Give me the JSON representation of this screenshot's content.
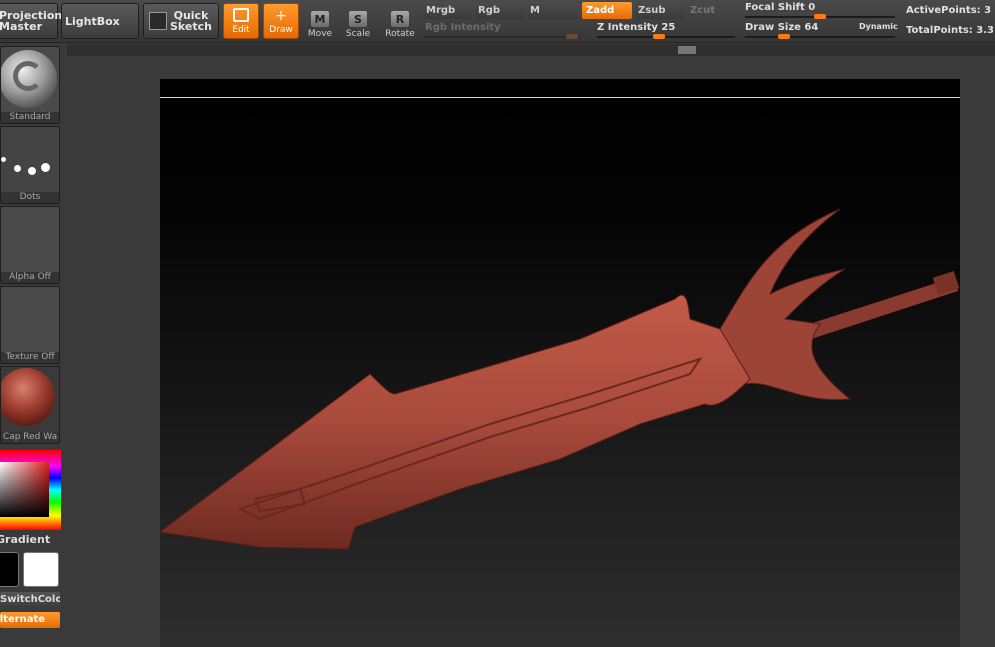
{
  "toolbar": {
    "projection_master": "Projection Master",
    "lightbox": "LightBox",
    "quick_sketch": "Quick Sketch",
    "edit": "Edit",
    "draw": "Draw",
    "move": "Move",
    "scale": "Scale",
    "rotate": "Rotate",
    "move_key": "M",
    "scale_key": "S",
    "rotate_key": "R"
  },
  "modes": {
    "mrgb": "Mrgb",
    "rgb": "Rgb",
    "m": "M",
    "zadd": "Zadd",
    "zsub": "Zsub",
    "zcut": "Zcut",
    "rgb_intensity_label": "Rgb Intensity",
    "z_intensity_label": "Z Intensity",
    "z_intensity_value": "25"
  },
  "brush_settings": {
    "focal_shift_label": "Focal Shift",
    "focal_shift_value": "0",
    "draw_size_label": "Draw Size",
    "draw_size_value": "64",
    "dynamic": "Dynamic"
  },
  "stats": {
    "active_points_label": "ActivePoints:",
    "active_points_value": "3",
    "total_points_label": "TotalPoints:",
    "total_points_value": "3.3"
  },
  "left_panel": {
    "brush": "Standard",
    "stroke": "Dots",
    "alpha": "Alpha Off",
    "texture": "Texture Off",
    "material": "Cap Red Wa",
    "gradient": "Gradient",
    "switch_color": "SwitchColor",
    "alternate": "Alternate"
  },
  "colors": {
    "accent": "#ff7a10",
    "model": "#a84a3c",
    "main_color": "#000000",
    "secondary_color": "#ffffff"
  }
}
